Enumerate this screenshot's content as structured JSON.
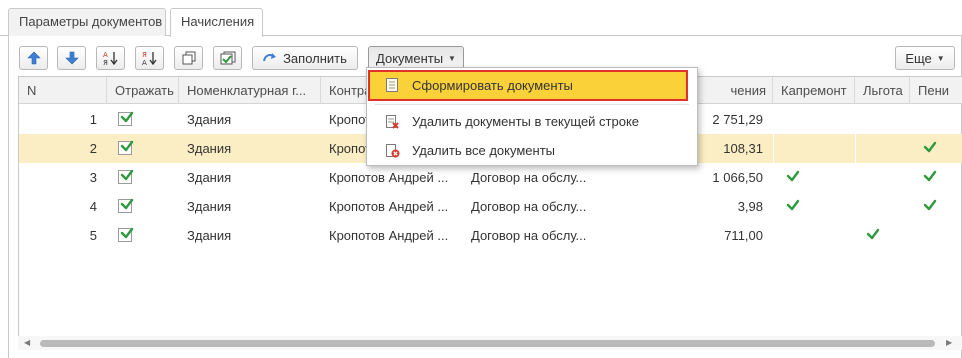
{
  "tabs": [
    {
      "label": "Параметры документов",
      "active": false
    },
    {
      "label": "Начисления",
      "active": true
    }
  ],
  "toolbar": {
    "move_up": "arrow-up-icon",
    "move_down": "arrow-down-icon",
    "sort_asc": "sort-ascending-icon",
    "sort_desc": "sort-descending-icon",
    "copy": "copy-icon",
    "select_all": "check-all-icon",
    "fill_label": "Заполнить",
    "documents_label": "Документы",
    "more_label": "Еще"
  },
  "columns": [
    "N",
    "Отражать",
    "Номенклатурная г...",
    "Контра",
    "",
    "чения",
    "Капремонт",
    "Льгота",
    "Пени"
  ],
  "rows": [
    {
      "n": "1",
      "reflect": true,
      "nomen": "Здания",
      "contr": "Кропот",
      "contract": "",
      "amount": "2 751,29",
      "kap": false,
      "lgota": false,
      "peni": false
    },
    {
      "n": "2",
      "reflect": true,
      "nomen": "Здания",
      "contr": "Кропот",
      "contract": "",
      "amount": "108,31",
      "kap": false,
      "lgota": false,
      "peni": true
    },
    {
      "n": "3",
      "reflect": true,
      "nomen": "Здания",
      "contr": "Кропотов Андрей ...",
      "contract": "Договор на обслу...",
      "amount": "1 066,50",
      "kap": true,
      "lgota": false,
      "peni": true
    },
    {
      "n": "4",
      "reflect": true,
      "nomen": "Здания",
      "contr": "Кропотов Андрей ...",
      "contract": "Договор на обслу...",
      "amount": "3,98",
      "kap": true,
      "lgota": false,
      "peni": true
    },
    {
      "n": "5",
      "reflect": true,
      "nomen": "Здания",
      "contr": "Кропотов Андрей ...",
      "contract": "Договор на обслу...",
      "amount": "711,00",
      "kap": false,
      "lgota": true,
      "peni": false
    }
  ],
  "menu": {
    "items": [
      {
        "label": "Сформировать документы",
        "icon": "document-icon",
        "highlighted": true
      },
      {
        "label": "Удалить документы в текущей строке",
        "icon": "delete-document-icon"
      },
      {
        "label": "Удалить все документы",
        "icon": "delete-all-icon"
      }
    ]
  },
  "colors": {
    "selected_row": "#fbeec4",
    "highlight": "#fbd13a",
    "highlight_border": "#e0322a",
    "check": "#2e9a3e"
  }
}
